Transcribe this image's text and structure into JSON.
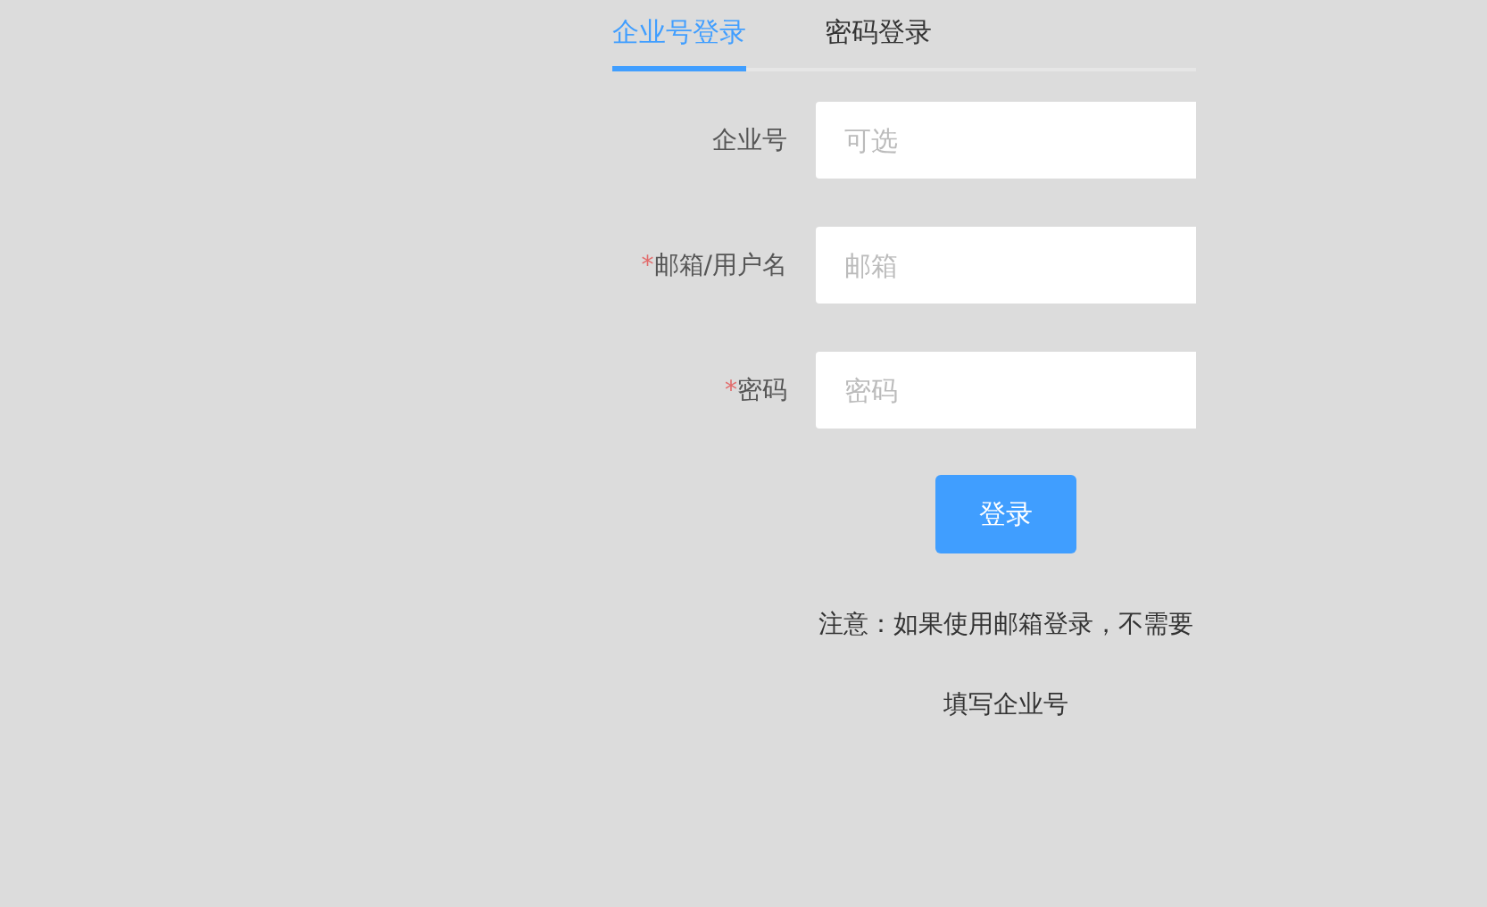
{
  "tabs": [
    {
      "label": "企业号登录",
      "selected": true
    },
    {
      "label": "密码登录",
      "selected": false
    }
  ],
  "fields": [
    {
      "label": "企业号",
      "placeholder": "可选"
    },
    {
      "required_mark": "*",
      "label": "邮箱/用户名",
      "placeholder": "邮箱"
    },
    {
      "required_mark": "*",
      "label": "密码",
      "placeholder": "密码"
    }
  ],
  "login_button": "登录",
  "note": "注意：如果使用邮箱登录，不需要填写企业号"
}
